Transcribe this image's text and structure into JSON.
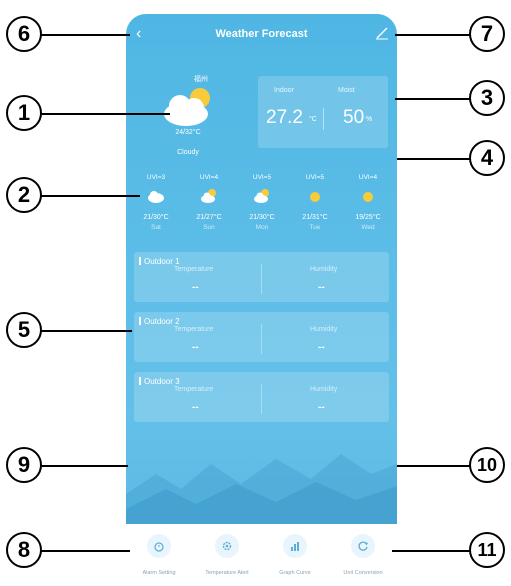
{
  "header": {
    "title": "Weather Forecast",
    "back_icon": "chevron-left-icon",
    "edit_icon": "edit-icon"
  },
  "current": {
    "location": "福州",
    "temp_range": "24/32°C",
    "condition": "Cloudy",
    "icon": "cloud-sun-icon"
  },
  "indoor": {
    "indoor_label": "Indoor",
    "moist_label": "Moist",
    "temperature": "27.2",
    "temp_unit": "°C",
    "humidity": "50",
    "humidity_unit": "%"
  },
  "forecast": [
    {
      "uvi": "UVI=3",
      "range": "21/30°C",
      "day": "Sat",
      "icon": "cloud-icon"
    },
    {
      "uvi": "UVI=4",
      "range": "21/27°C",
      "day": "Sun",
      "icon": "cloud-sun-icon"
    },
    {
      "uvi": "UVI=5",
      "range": "21/30°C",
      "day": "Mon",
      "icon": "cloud-sun-icon"
    },
    {
      "uvi": "UVI=5",
      "range": "21/31°C",
      "day": "Tue",
      "icon": "sun-icon"
    },
    {
      "uvi": "UVI=4",
      "range": "19/25°C",
      "day": "Wed",
      "icon": "sun-icon"
    }
  ],
  "outdoor": [
    {
      "name": "Outdoor 1",
      "temp_label": "Temperature",
      "hum_label": "Humidity",
      "temp_value": "--",
      "hum_value": "--"
    },
    {
      "name": "Outdoor 2",
      "temp_label": "Temperature",
      "hum_label": "Humidity",
      "temp_value": "--",
      "hum_value": "--"
    },
    {
      "name": "Outdoor 3",
      "temp_label": "Temperature",
      "hum_label": "Humidity",
      "temp_value": "--",
      "hum_value": "--"
    }
  ],
  "tools": [
    {
      "label": "Alarm Setting",
      "icon": "alarm-clock-icon"
    },
    {
      "label": "Temperature Alert",
      "icon": "gear-icon"
    },
    {
      "label": "Graph Curve",
      "icon": "bar-chart-icon"
    },
    {
      "label": "Unit Conversion",
      "icon": "refresh-icon"
    }
  ],
  "callouts": [
    "1",
    "2",
    "3",
    "4",
    "5",
    "6",
    "7",
    "8",
    "9",
    "10",
    "11"
  ],
  "colors": {
    "accent": "#4fb6e3",
    "card": "rgba(255,255,255,0.18)"
  }
}
